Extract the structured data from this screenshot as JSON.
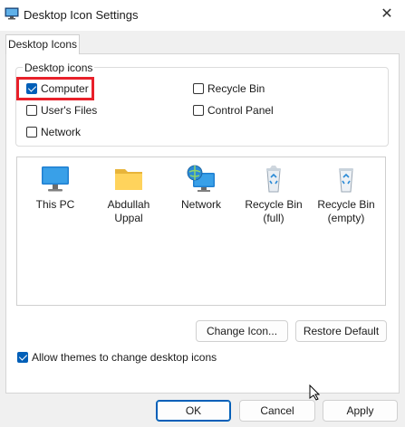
{
  "window": {
    "title": "Desktop Icon Settings"
  },
  "tabs": [
    {
      "label": "Desktop Icons"
    }
  ],
  "group": {
    "label": "Desktop icons",
    "checkboxes": [
      {
        "label": "Computer",
        "checked": true
      },
      {
        "label": "Recycle Bin",
        "checked": false
      },
      {
        "label": "User's Files",
        "checked": false
      },
      {
        "label": "Control Panel",
        "checked": false
      },
      {
        "label": "Network",
        "checked": false
      }
    ]
  },
  "icons": [
    {
      "name": "monitor-icon",
      "label": "This PC"
    },
    {
      "name": "folder-icon",
      "label": "Abdullah\nUppal"
    },
    {
      "name": "network-globe-icon",
      "label": "Network"
    },
    {
      "name": "recycle-bin-full-icon",
      "label": "Recycle Bin\n(full)"
    },
    {
      "name": "recycle-bin-empty-icon",
      "label": "Recycle Bin\n(empty)"
    }
  ],
  "buttons": {
    "change_icon": "Change Icon...",
    "restore_default": "Restore Default",
    "ok": "OK",
    "cancel": "Cancel",
    "apply": "Apply"
  },
  "allow_themes": {
    "label": "Allow themes to change desktop icons",
    "checked": true
  },
  "colors": {
    "accent": "#005fb8",
    "highlight": "#e8202a"
  }
}
